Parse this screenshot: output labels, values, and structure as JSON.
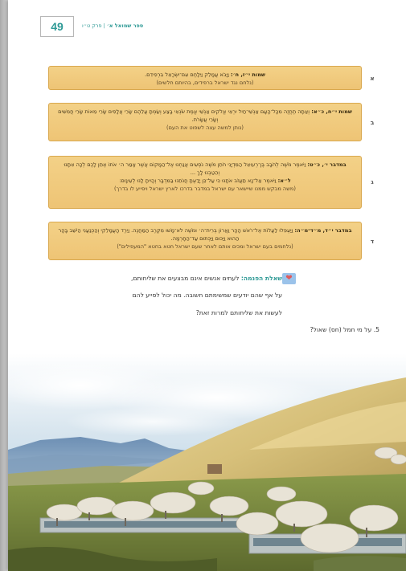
{
  "page": {
    "number": "49",
    "book_title": "ספר שמואל א׳",
    "separator": " | ",
    "chapter": "פרק ט״ו"
  },
  "sources": [
    {
      "letter": "א",
      "ref": "שמות י״ז, ח׳:",
      "text": " וַיָּבֹא עֲמָלֵק וַיִּלָּחֶם עִם־יִשְׂרָאֵל בִּרְפִידִם.",
      "ref2": "",
      "text2": "",
      "note": "(נלחם נגד ישראל ברפידים, בהיותם חלשים)"
    },
    {
      "letter": "ב",
      "ref": "שמות י״ח, כ״א:",
      "text": " וְאַתָּה תֶחֱזֶה מִכָּל־הָעָם אַנְשֵׁי־חַיִל יִרְאֵי אֱלֹקִים אַנְשֵׁי אֱמֶת שֹׂנְאֵי בָצַע וְשַׂמְתָּ עֲלֵהֶם שָׂרֵי אֲלָפִים שָׂרֵי מֵאוֹת שָׂרֵי חֲמִשִּׁים וְשָׂרֵי עֲשָׂרֹת.",
      "ref2": "",
      "text2": "",
      "note": "(נותן למשה עצה לשפוט את העם)"
    },
    {
      "letter": "ג",
      "ref": "במדבר י׳, כ״ט:",
      "text": " וַיֹּאמֶר מֹשֶׁה לְחֹבָב בֶּן־רְעוּאֵל הַמִּדְיָנִי חֹתֵן מֹשֶׁה נֹסְעִים אֲנַחְנוּ אֶל־הַמָּקוֹם אֲשֶׁר אָמַר ה׳ אֹתוֹ אֶתֵּן לָכֶם לְכָה אִתָּנוּ וְהֵטַבְנוּ לָךְ ...",
      "ref2": "ל״א:",
      "text2": " וַיֹּאמֶר אַל־נָא תַּעֲזֹב אֹתָנוּ כִּי עַל־כֵּן יָדַעְתָּ חֲנֹתֵנוּ בַּמִּדְבָּר וְהָיִיתָ לָּנוּ לְעֵינָיִם:",
      "note": "(משה מבקש ממנו שיישאר עם ישראל במדבר בדרכו לארץ ישראל ויסייע לו בדרך)"
    },
    {
      "letter": "ד",
      "ref": "במדבר י״ד, מ״ד־מ״ה:",
      "text": " וַיַּעְפִּלוּ לַעֲלוֹת אֶל־רֹאשׁ הָהָר וַאֲרוֹן בְּרִית־ה׳ וּמֹשֶׁה לֹא־מָשׁוּ מִקֶּרֶב הַמַּחֲנֶה. וַיֵּרֶד הָעֲמָלֵקִי וְהַכְּנַעֲנִי הַיֹּשֵׁב בָּהָר הַהוּא וַיַּכּוּם וַיַּכְּתוּם עַד־הַחָרְמָה.",
      "ref2": "",
      "text2": "",
      "note": "(נלחמים בעם ישראל ומכים אותם לאחר שעם ישראל חטא בחטא \"המעפילים\")"
    }
  ],
  "thinking_question": {
    "label": "שאלת הפנמה:",
    "line1": " לעתים אנשים אינם מבצעים את שליחותם,",
    "line2": "על אף שהם יודעים שמשימתם חשובה. מה יכול לסייע להם",
    "line3": "לעשות את שליחותם למרות זאת?"
  },
  "exercise": {
    "number": "5.",
    "text": " על מי חמל (חס) שאול?"
  },
  "colors": {
    "teal": "#2f9a96",
    "box_fill": "#f0c97b",
    "box_border": "#d9a84e"
  },
  "icons": {
    "question_icon": "heart-icon"
  }
}
